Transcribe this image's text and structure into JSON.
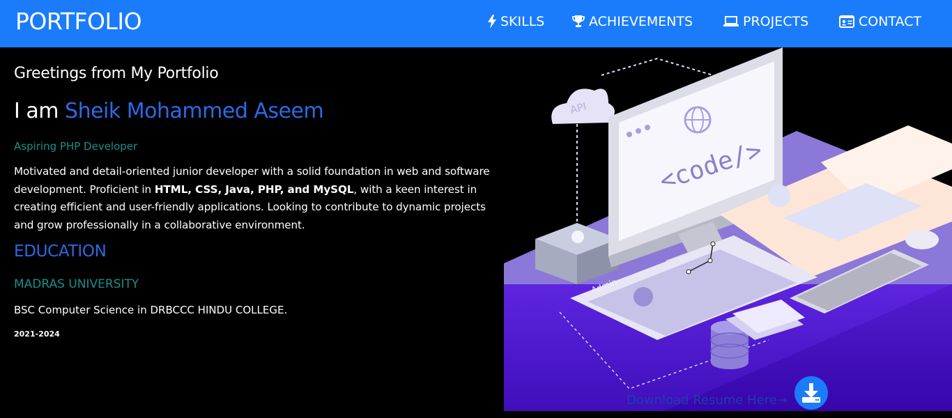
{
  "nav": {
    "brand": "PORTFOLIO",
    "items": [
      {
        "label": "SKILLS",
        "icon": "bolt-icon"
      },
      {
        "label": "ACHIEVEMENTS",
        "icon": "trophy-icon"
      },
      {
        "label": "PROJECTS",
        "icon": "laptop-icon"
      },
      {
        "label": "CONTACT",
        "icon": "id-card-icon"
      }
    ]
  },
  "hero": {
    "greeting": "Greetings from My Portfolio",
    "intro_prefix": "I am ",
    "name": "Sheik Mohammed Aseem",
    "role": "Aspiring PHP Developer",
    "bio_part1": "Motivated and detail-oriented junior developer with a solid foundation in web and software development. Proficient in ",
    "bio_skills": "HTML, CSS, Java, PHP, and MySQL",
    "bio_part2": ", with a keen interest in creating efficient and user-friendly applications. Looking to contribute to dynamic projects and grow professionally in a collaborative environment.",
    "illustration": {
      "api_label": "API",
      "code_label": "<code/>",
      "admin_label": "Admin"
    }
  },
  "education": {
    "heading": "EDUCATION",
    "university": "MADRAS UNIVERSITY",
    "degree": "BSC Computer Science in DRBCCC HINDU COLLEGE.",
    "years": "2021-2024"
  },
  "download": {
    "label": "Download Resume Here→",
    "icon": "download-icon"
  },
  "colors": {
    "navbar": "#1a7cfa",
    "accent_blue": "#2a6ae5",
    "accent_teal": "#1a8f8a",
    "illustration_purple": "#4a0fd0"
  }
}
